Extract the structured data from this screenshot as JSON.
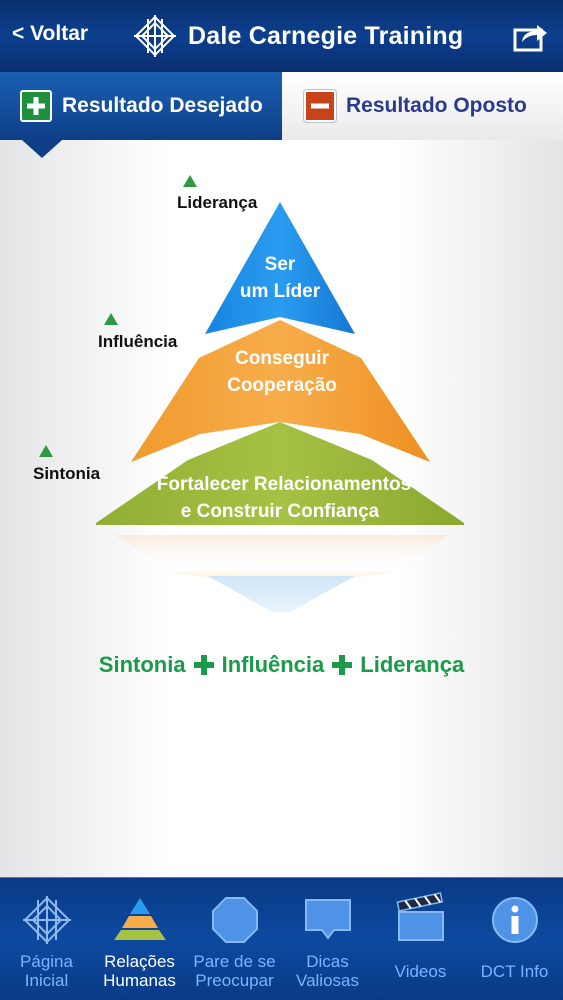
{
  "header": {
    "back_label": "< Voltar",
    "title": "Dale Carnegie Training",
    "share_icon": "share-icon"
  },
  "tabs": [
    {
      "label": "Resultado Desejado",
      "icon": "plus-icon",
      "active": true
    },
    {
      "label": "Resultado Oposto",
      "icon": "minus-icon",
      "active": false
    }
  ],
  "pyramid": {
    "labels": [
      "Liderança",
      "Influência",
      "Sintonia"
    ],
    "layers": [
      {
        "line1": "Ser",
        "line2": "um Líder",
        "color": "#1f8fe6"
      },
      {
        "line1": "Conseguir",
        "line2": "Cooperação",
        "color": "#f29c3a"
      },
      {
        "line1": "Fortalecer Relacionamentos",
        "line2": "e Construir Confiança",
        "color": "#9ab83a"
      }
    ],
    "marker_color": "#2e9a44"
  },
  "formula": {
    "terms": [
      "Sintonia",
      "Influência",
      "Liderança"
    ],
    "color": "#1a9a4a"
  },
  "nav": [
    {
      "line1": "Página",
      "line2": "Inicial",
      "icon": "home-logo-icon",
      "active": false
    },
    {
      "line1": "Relações",
      "line2": "Humanas",
      "icon": "pyramid-icon",
      "active": true
    },
    {
      "line1": "Pare de se",
      "line2": "Preocupar",
      "icon": "stop-octagon-icon",
      "active": false
    },
    {
      "line1": "Dicas",
      "line2": "Valiosas",
      "icon": "speech-bubble-icon",
      "active": false
    },
    {
      "line1": "Videos",
      "line2": "",
      "icon": "clapperboard-icon",
      "active": false
    },
    {
      "line1": "DCT Info",
      "line2": "",
      "icon": "info-icon",
      "active": false
    }
  ]
}
